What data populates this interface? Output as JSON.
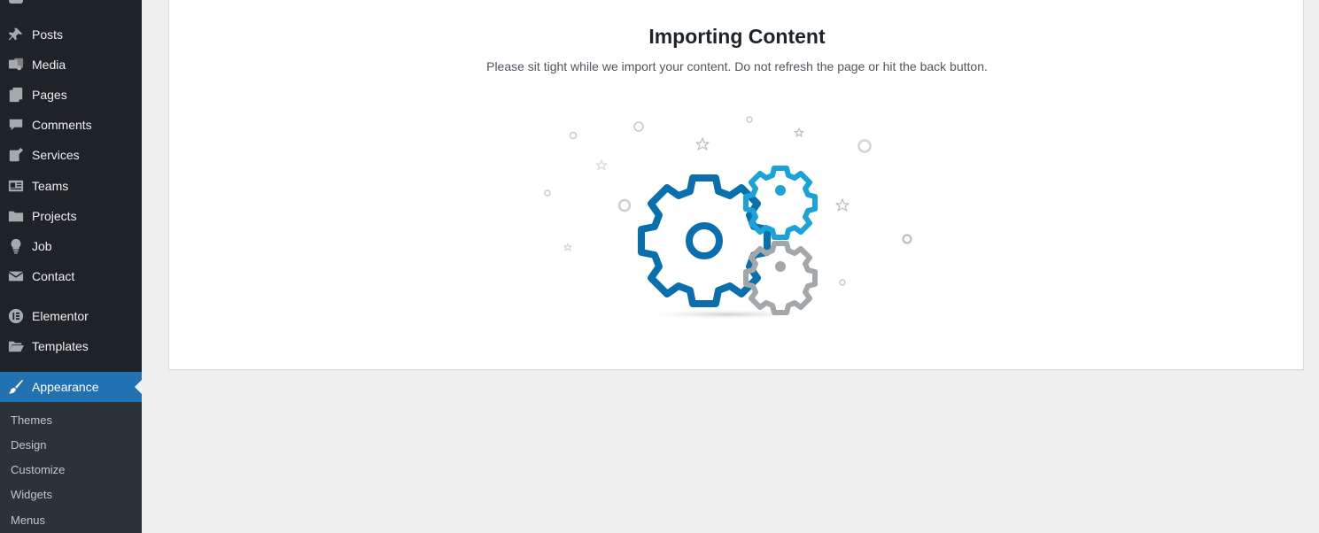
{
  "sidebar": {
    "items": [
      {
        "label": "Posts",
        "icon": "pin-icon"
      },
      {
        "label": "Media",
        "icon": "media-icon"
      },
      {
        "label": "Pages",
        "icon": "pages-icon"
      },
      {
        "label": "Comments",
        "icon": "comment-icon"
      },
      {
        "label": "Services",
        "icon": "edit-page-icon"
      },
      {
        "label": "Teams",
        "icon": "id-card-icon"
      },
      {
        "label": "Projects",
        "icon": "folder-icon"
      },
      {
        "label": "Job",
        "icon": "lightbulb-icon"
      },
      {
        "label": "Contact",
        "icon": "email-icon"
      },
      {
        "label": "Elementor",
        "icon": "elementor-icon"
      },
      {
        "label": "Templates",
        "icon": "folder-open-icon"
      },
      {
        "label": "Appearance",
        "icon": "brush-icon",
        "active": true
      }
    ],
    "submenu": [
      "Themes",
      "Design",
      "Customize",
      "Widgets",
      "Menus"
    ]
  },
  "main": {
    "title": "Importing Content",
    "subtitle": "Please sit tight while we import your content. Do not refresh the page or hit the back button."
  },
  "colors": {
    "sidebar_bg": "#1d2327",
    "active_bg": "#2271b1",
    "gear_dark_blue": "#0a6fad",
    "gear_light_blue": "#1aa3d9",
    "gear_gray": "#a4a7aa"
  }
}
